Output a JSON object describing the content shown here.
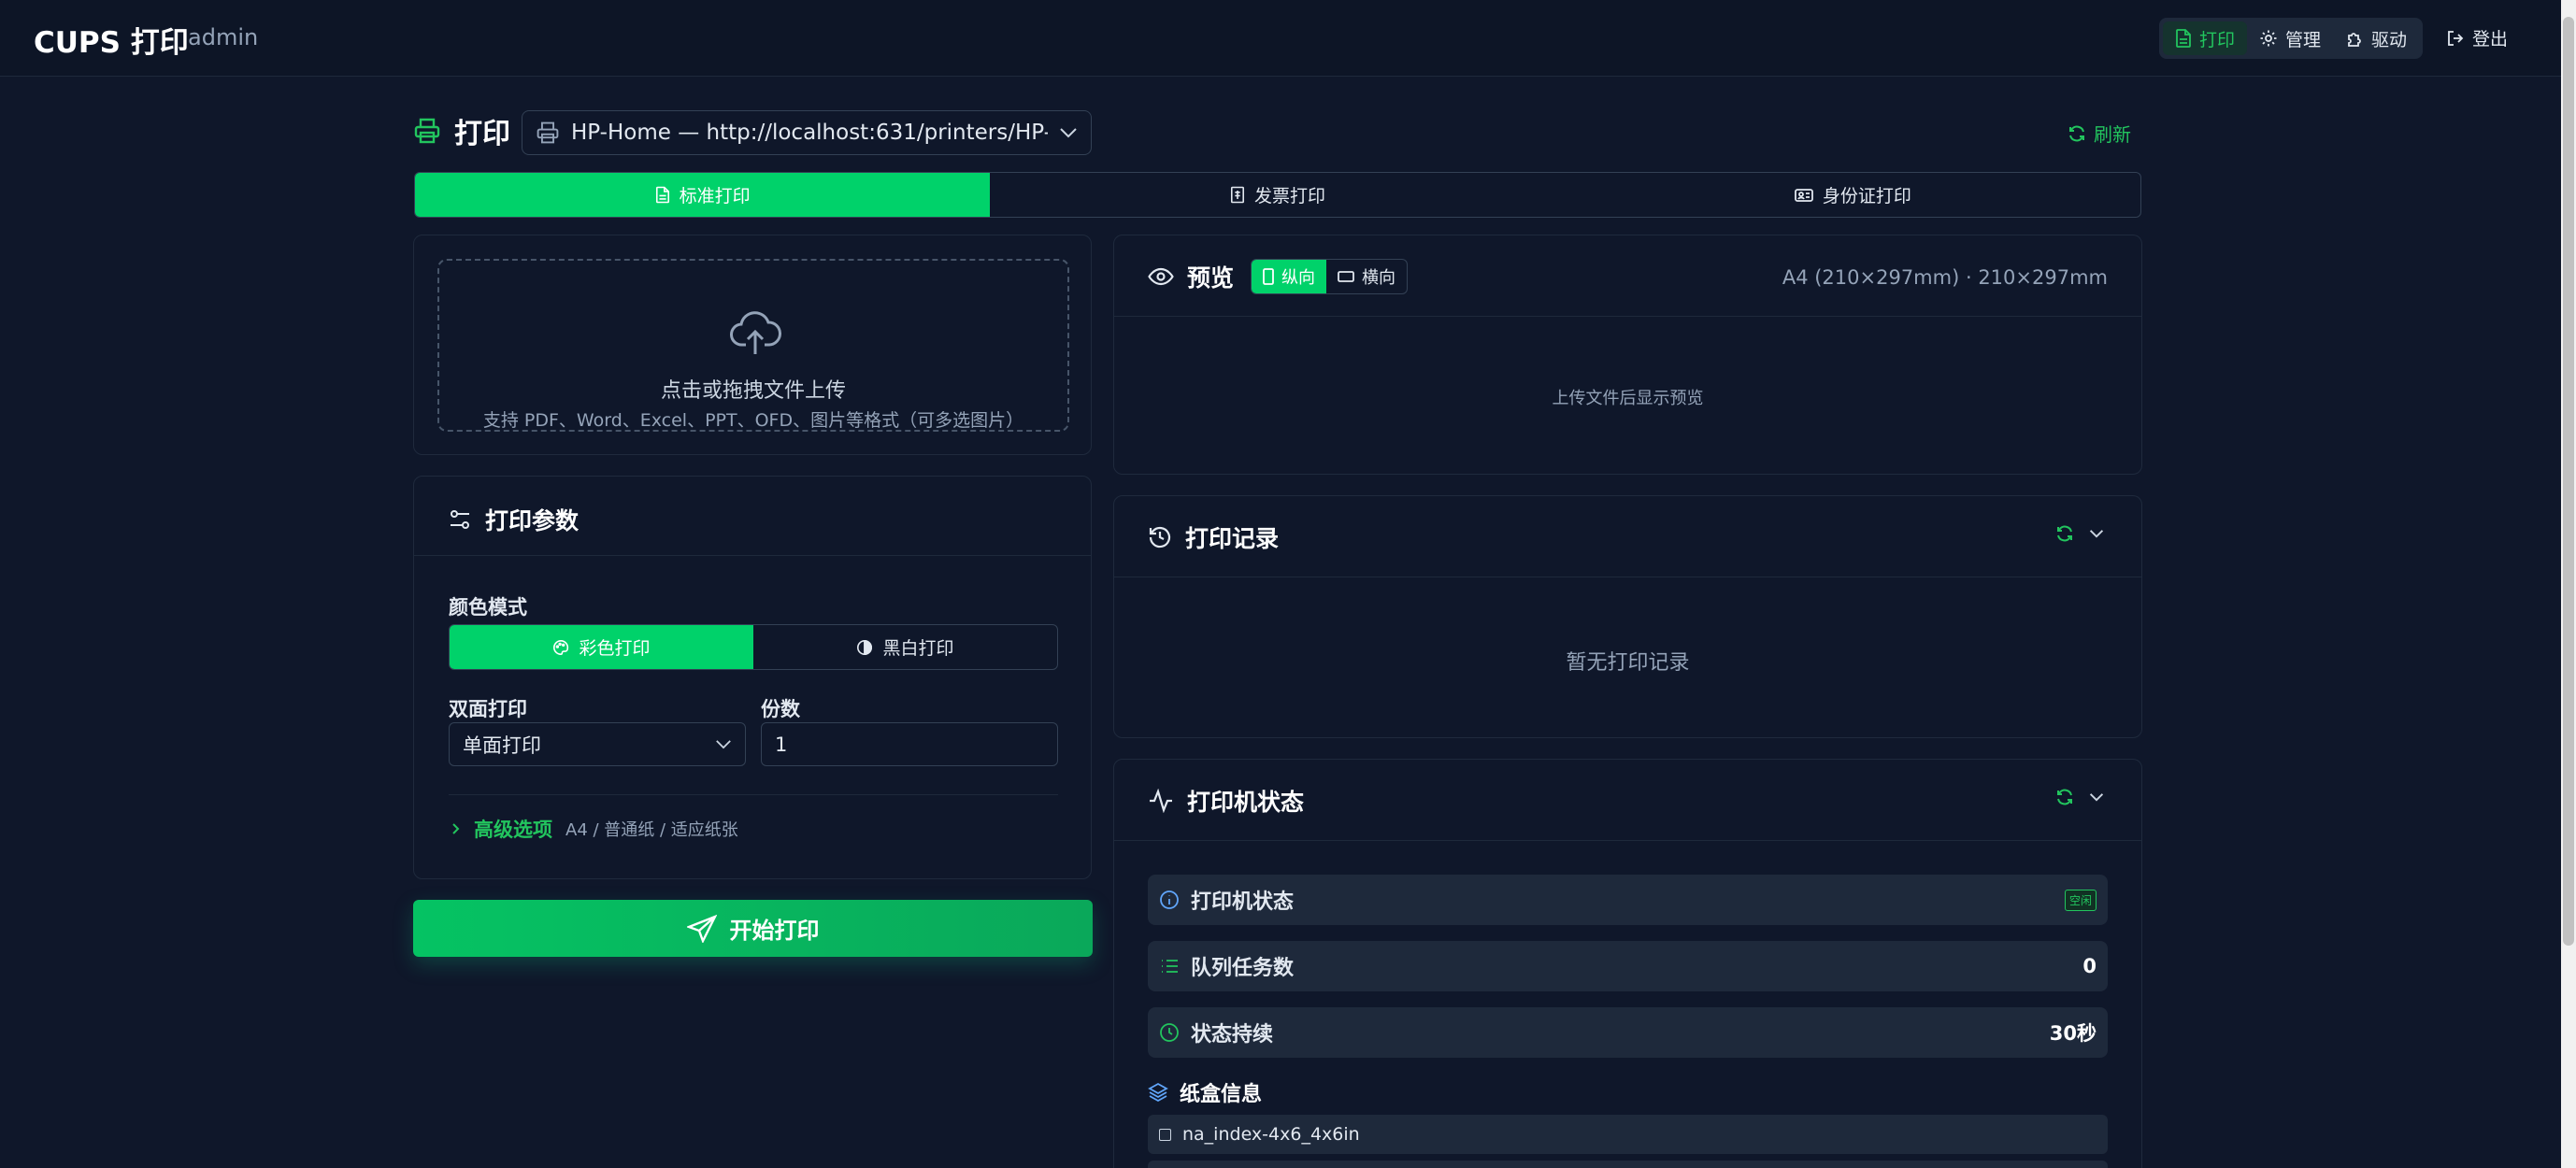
{
  "app": {
    "title": "CUPS 打印",
    "user": "admin"
  },
  "topnav": {
    "items": [
      {
        "label": "打印",
        "icon": "file-text-icon",
        "active": true
      },
      {
        "label": "管理",
        "icon": "gear-icon",
        "active": false
      },
      {
        "label": "驱动",
        "icon": "puzzle-icon",
        "active": false
      }
    ],
    "logout": "登出"
  },
  "page": {
    "title": "打印",
    "printer": "HP-Home — http://localhost:631/printers/HP-Ho···",
    "refresh": "刷新"
  },
  "tabs": [
    {
      "label": "标准打印",
      "icon": "file-text-icon",
      "active": true
    },
    {
      "label": "发票打印",
      "icon": "receipt-icon",
      "active": false
    },
    {
      "label": "身份证打印",
      "icon": "id-card-icon",
      "active": false
    }
  ],
  "upload": {
    "title": "点击或拖拽文件上传",
    "hint": "支持 PDF、Word、Excel、PPT、OFD、图片等格式（可多选图片）"
  },
  "params": {
    "title": "打印参数",
    "color_label": "颜色模式",
    "color_options": [
      "彩色打印",
      "黑白打印"
    ],
    "duplex_label": "双面打印",
    "duplex_value": "单面打印",
    "copies_label": "份数",
    "copies_value": "1",
    "advanced_label": "高级选项",
    "advanced_summary": "A4 / 普通纸 / 适应纸张"
  },
  "start_button": "开始打印",
  "preview": {
    "title": "预览",
    "orient_portrait": "纵向",
    "orient_landscape": "横向",
    "paper_info": "A4 (210×297mm) · 210×297mm",
    "empty": "上传文件后显示预览"
  },
  "history": {
    "title": "打印记录",
    "empty": "暂无打印记录"
  },
  "status": {
    "title": "打印机状态",
    "rows": [
      {
        "label": "打印机状态",
        "value": "空闲",
        "icon": "info-icon"
      },
      {
        "label": "队列任务数",
        "value": "0",
        "icon": "list-icon"
      },
      {
        "label": "状态持续",
        "value": "30秒",
        "icon": "clock-icon"
      }
    ],
    "trays_title": "纸盒信息",
    "trays": [
      "na_index-4x6_4x6in"
    ]
  },
  "colors": {
    "accent": "#00d26a",
    "accent_text": "#22c55e",
    "background": "#0f172a"
  }
}
